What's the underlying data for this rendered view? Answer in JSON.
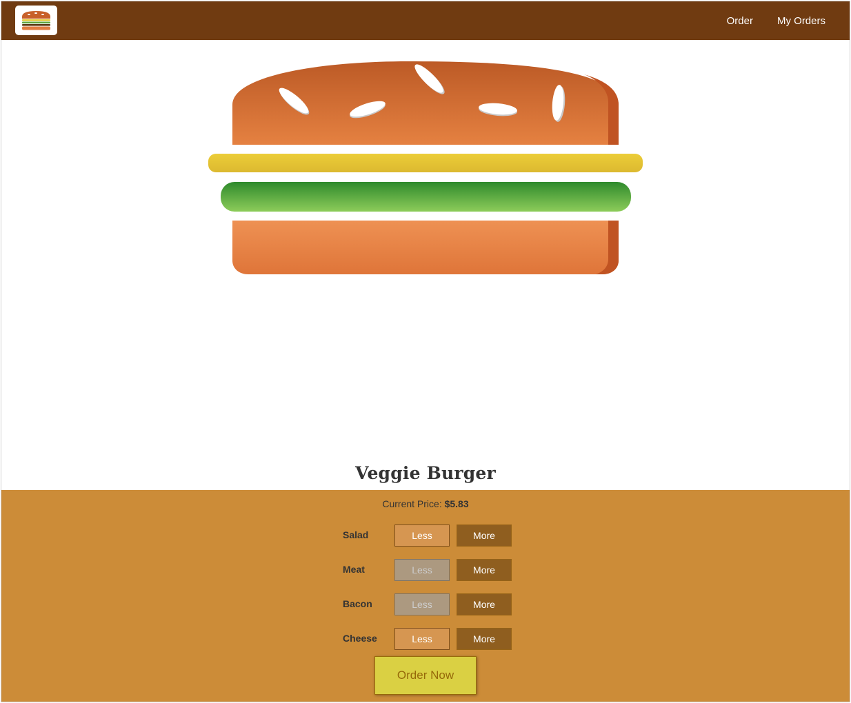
{
  "header": {
    "logo_alt": "Burger Logo",
    "nav": [
      {
        "label": "Order"
      },
      {
        "label": "My Orders"
      }
    ]
  },
  "burger": {
    "name": "Veggie Burger",
    "ingredients": [
      "cheese",
      "salad"
    ]
  },
  "controls": {
    "price_label": "Current Price:",
    "price_value": "$5.83",
    "rows": [
      {
        "label": "Salad",
        "less": "Less",
        "more": "More",
        "less_disabled": false
      },
      {
        "label": "Meat",
        "less": "Less",
        "more": "More",
        "less_disabled": true
      },
      {
        "label": "Bacon",
        "less": "Less",
        "more": "More",
        "less_disabled": true
      },
      {
        "label": "Cheese",
        "less": "Less",
        "more": "More",
        "less_disabled": false
      }
    ],
    "order_label": "Order Now"
  },
  "colors": {
    "header_bg": "#703b11",
    "controls_bg": "#cc8c38",
    "bun_top": "#c15a28",
    "cheese": "#e5c834",
    "salad": "#5da53f",
    "order_button": "#dad043"
  }
}
